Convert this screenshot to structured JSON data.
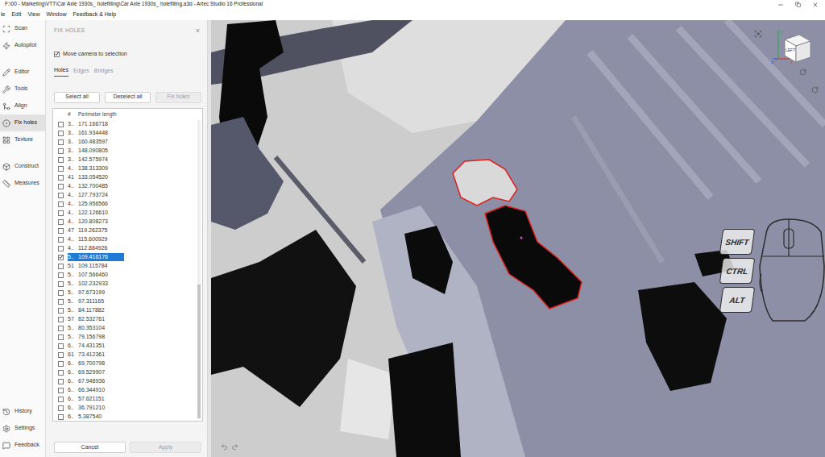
{
  "window": {
    "title": "F:\\00 - Marketing\\VTT\\Car Axle 1930s_ holefilling\\Car Axle 1930s_ holefilling.a3d - Artec Studio 16 Professional"
  },
  "menu": [
    "le",
    "Edit",
    "View",
    "Window",
    "Feedback & Help"
  ],
  "sidebar": {
    "groups": [
      [
        {
          "label": "Scan",
          "selected": false
        },
        {
          "label": "Autopilot",
          "selected": false
        }
      ],
      [
        {
          "label": "Editor",
          "selected": false
        },
        {
          "label": "Tools",
          "selected": false
        },
        {
          "label": "Align",
          "selected": false
        },
        {
          "label": "Fix holes",
          "selected": true
        },
        {
          "label": "Texture",
          "selected": false
        }
      ],
      [
        {
          "label": "Construct",
          "selected": false
        },
        {
          "label": "Measures",
          "selected": false
        }
      ]
    ],
    "bottom": [
      {
        "label": "History",
        "selected": false
      },
      {
        "label": "Settings",
        "selected": false
      },
      {
        "label": "Feedback",
        "selected": false
      }
    ]
  },
  "panel": {
    "title": "FIX HOLES",
    "close": "×",
    "move_camera": {
      "label": "Move camera to selection",
      "checked": true
    },
    "tabs": [
      {
        "label": "Holes",
        "selected": true
      },
      {
        "label": "Edges",
        "selected": false
      },
      {
        "label": "Bridges",
        "selected": false
      }
    ],
    "buttons": [
      {
        "label": "Select all",
        "disabled": false
      },
      {
        "label": "Deselect all",
        "disabled": false
      },
      {
        "label": "Fix holes",
        "disabled": true
      }
    ],
    "table": {
      "columns": [
        "#",
        "Perimeter length"
      ],
      "scroll": {
        "level": 1
      },
      "rows": [
        {
          "id": "3..",
          "perimeter": "171.166718",
          "checked": false,
          "selected": false
        },
        {
          "id": "3..",
          "perimeter": "161.934448",
          "checked": false,
          "selected": false
        },
        {
          "id": "3..",
          "perimeter": "160.483597",
          "checked": false,
          "selected": false
        },
        {
          "id": "3..",
          "perimeter": "148.090805",
          "checked": false,
          "selected": false
        },
        {
          "id": "3..",
          "perimeter": "142.575974",
          "checked": false,
          "selected": false
        },
        {
          "id": "4..",
          "perimeter": "138.313309",
          "checked": false,
          "selected": false
        },
        {
          "id": "41",
          "perimeter": "133.054520",
          "checked": false,
          "selected": false
        },
        {
          "id": "4..",
          "perimeter": "132.700485",
          "checked": false,
          "selected": false
        },
        {
          "id": "4..",
          "perimeter": "127.793724",
          "checked": false,
          "selected": false
        },
        {
          "id": "4..",
          "perimeter": "125.956566",
          "checked": false,
          "selected": false
        },
        {
          "id": "4..",
          "perimeter": "122.126610",
          "checked": false,
          "selected": false
        },
        {
          "id": "4..",
          "perimeter": "120.808273",
          "checked": false,
          "selected": false
        },
        {
          "id": "47",
          "perimeter": "119.262375",
          "checked": false,
          "selected": false
        },
        {
          "id": "4..",
          "perimeter": "115.600929",
          "checked": false,
          "selected": false
        },
        {
          "id": "4..",
          "perimeter": "112.884926",
          "checked": false,
          "selected": false
        },
        {
          "id": "5..",
          "perimeter": "109.416176",
          "checked": true,
          "selected": true
        },
        {
          "id": "51",
          "perimeter": "109.115784",
          "checked": false,
          "selected": false
        },
        {
          "id": "5..",
          "perimeter": "107.566460",
          "checked": false,
          "selected": false
        },
        {
          "id": "5..",
          "perimeter": "102.232933",
          "checked": false,
          "selected": false
        },
        {
          "id": "5..",
          "perimeter": "97.673199",
          "checked": false,
          "selected": false
        },
        {
          "id": "5..",
          "perimeter": "97.311165",
          "checked": false,
          "selected": false
        },
        {
          "id": "5..",
          "perimeter": "84.117882",
          "checked": false,
          "selected": false
        },
        {
          "id": "57",
          "perimeter": "82.532761",
          "checked": false,
          "selected": false
        },
        {
          "id": "5..",
          "perimeter": "80.353104",
          "checked": false,
          "selected": false
        },
        {
          "id": "5..",
          "perimeter": "79.156798",
          "checked": false,
          "selected": false
        },
        {
          "id": "6..",
          "perimeter": "74.431351",
          "checked": false,
          "selected": false
        },
        {
          "id": "61",
          "perimeter": "73.412361",
          "checked": false,
          "selected": false
        },
        {
          "id": "6..",
          "perimeter": "69.700798",
          "checked": false,
          "selected": false
        },
        {
          "id": "6..",
          "perimeter": "69.529907",
          "checked": false,
          "selected": false
        },
        {
          "id": "6..",
          "perimeter": "67.948936",
          "checked": false,
          "selected": false
        },
        {
          "id": "6..",
          "perimeter": "66.344910",
          "checked": false,
          "selected": false
        },
        {
          "id": "6..",
          "perimeter": "57.621151",
          "checked": false,
          "selected": false
        },
        {
          "id": "6..",
          "perimeter": "36.791210",
          "checked": false,
          "selected": false
        },
        {
          "id": "6..",
          "perimeter": "5.387540",
          "checked": false,
          "selected": false
        }
      ]
    },
    "footer_buttons": [
      {
        "label": "Cancel",
        "disabled": false
      },
      {
        "label": "Apply",
        "disabled": true
      }
    ]
  },
  "viewport": {
    "mouse_keys": [
      "SHIFT",
      "CTRL",
      "ALT"
    ],
    "view_cube": {
      "face": "LEFT",
      "axes": [
        {
          "label": "y",
          "color": "#2fa84f"
        },
        {
          "label": "x",
          "color": "#d93a2b"
        },
        {
          "label": "z",
          "color": "#2f5fd9"
        }
      ]
    }
  }
}
